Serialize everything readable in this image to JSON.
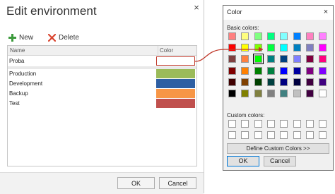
{
  "edit_dialog": {
    "title": "Edit environment",
    "close_glyph": "×",
    "toolbar": {
      "new_label": "New",
      "delete_label": "Delete"
    },
    "columns": {
      "name": "Name",
      "color": "Color"
    },
    "rows": [
      {
        "name": "Proba",
        "color": "#ffffff",
        "selected": true
      },
      {
        "name": "Production",
        "color": "#9bbb59"
      },
      {
        "name": "Development",
        "color": "#2e5fa3"
      },
      {
        "name": "Backup",
        "color": "#f79646"
      },
      {
        "name": "Test",
        "color": "#c0504d"
      }
    ],
    "ok_label": "OK",
    "cancel_label": "Cancel"
  },
  "color_dialog": {
    "title": "Color",
    "close_glyph": "×",
    "basic_colors_label": "Basic colors:",
    "basic_colors": [
      [
        "#ff8080",
        "#ffff80",
        "#80ff80",
        "#00ff80",
        "#80ffff",
        "#0080ff",
        "#ff80c0",
        "#ff80ff"
      ],
      [
        "#ff0000",
        "#ffff00",
        "#80ff00",
        "#00ff40",
        "#00ffff",
        "#0080c0",
        "#8080c0",
        "#ff00ff"
      ],
      [
        "#804040",
        "#ff8040",
        "#00ff00",
        "#008080",
        "#004080",
        "#8080ff",
        "#800040",
        "#ff0080"
      ],
      [
        "#800000",
        "#ff8000",
        "#008000",
        "#008040",
        "#0000ff",
        "#0000a0",
        "#800080",
        "#8000ff"
      ],
      [
        "#400000",
        "#804000",
        "#004000",
        "#004040",
        "#000080",
        "#000040",
        "#400040",
        "#400080"
      ],
      [
        "#000000",
        "#808000",
        "#808040",
        "#808080",
        "#408080",
        "#c0c0c0",
        "#400040",
        "#ffffff"
      ]
    ],
    "selected_basic": {
      "row": 2,
      "col": 2
    },
    "custom_colors_label": "Custom colors:",
    "custom_rows": 2,
    "custom_cols": 8,
    "define_label": "Define Custom Colors >>",
    "ok_label": "OK",
    "cancel_label": "Cancel"
  },
  "accent_colors": {
    "connector": "#c0392b",
    "selection_border": "#c0392b",
    "new_icon": "#3c9a3c",
    "delete_icon": "#d9442f"
  }
}
